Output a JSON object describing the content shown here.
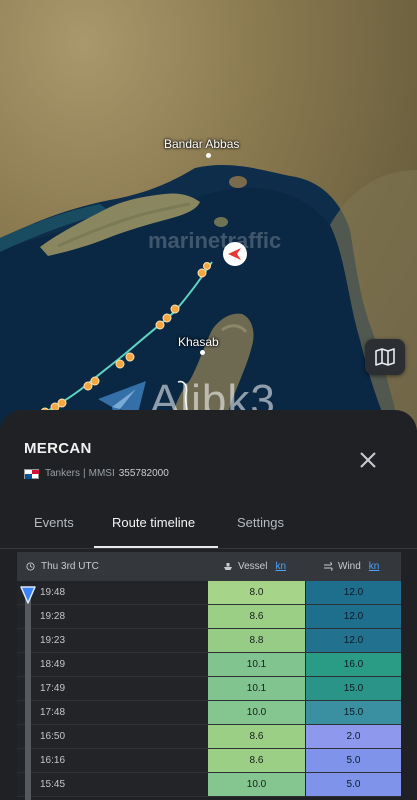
{
  "map": {
    "labels": {
      "bandar_abbas": "Bandar Abbas",
      "khasab": "Khasab"
    },
    "watermark_top": "marinetraffic",
    "watermark_bottom": "Alibk3",
    "route_color": "#5fd3c0",
    "waypoint_color": "#f4a741",
    "vessel_marker_color": "#e53935",
    "icons": {
      "layers": "map-icon",
      "vessel": "vessel-arrow-icon",
      "telegram": "telegram-plane-icon"
    }
  },
  "panel": {
    "vessel_name": "MERCAN",
    "vessel_type": "Tankers",
    "separator": "|",
    "mmsi_label": "MMSI",
    "mmsi": "355782000",
    "flag": "Panama",
    "tabs": [
      {
        "label": "Events",
        "active": false
      },
      {
        "label": "Route timeline",
        "active": true
      },
      {
        "label": "Settings",
        "active": false
      }
    ]
  },
  "table": {
    "date_header": "Thu 3rd UTC",
    "vessel_header": "Vessel",
    "wind_header": "Wind",
    "unit": "kn",
    "rows": [
      {
        "time": "19:48",
        "vessel": "8.0",
        "wind": "12.0",
        "vessel_color": "#a6d489",
        "wind_color": "#1e6e8e"
      },
      {
        "time": "19:28",
        "vessel": "8.6",
        "wind": "12.0",
        "vessel_color": "#9ccf86",
        "wind_color": "#1e6e8e"
      },
      {
        "time": "19:23",
        "vessel": "8.8",
        "wind": "12.0",
        "vessel_color": "#97cc87",
        "wind_color": "#22718f"
      },
      {
        "time": "18:49",
        "vessel": "10.1",
        "wind": "16.0",
        "vessel_color": "#82c490",
        "wind_color": "#2a9c86"
      },
      {
        "time": "17:49",
        "vessel": "10.1",
        "wind": "15.0",
        "vessel_color": "#82c490",
        "wind_color": "#2b9488"
      },
      {
        "time": "17:48",
        "vessel": "10.0",
        "wind": "15.0",
        "vessel_color": "#85c58f",
        "wind_color": "#3a8fa0"
      },
      {
        "time": "16:50",
        "vessel": "8.6",
        "wind": "2.0",
        "vessel_color": "#9ccf86",
        "wind_color": "#8e98ec"
      },
      {
        "time": "16:16",
        "vessel": "8.6",
        "wind": "5.0",
        "vessel_color": "#9ccf86",
        "wind_color": "#7f93ea"
      },
      {
        "time": "15:45",
        "vessel": "10.0",
        "wind": "5.0",
        "vessel_color": "#85c58f",
        "wind_color": "#7f93ea"
      }
    ]
  }
}
